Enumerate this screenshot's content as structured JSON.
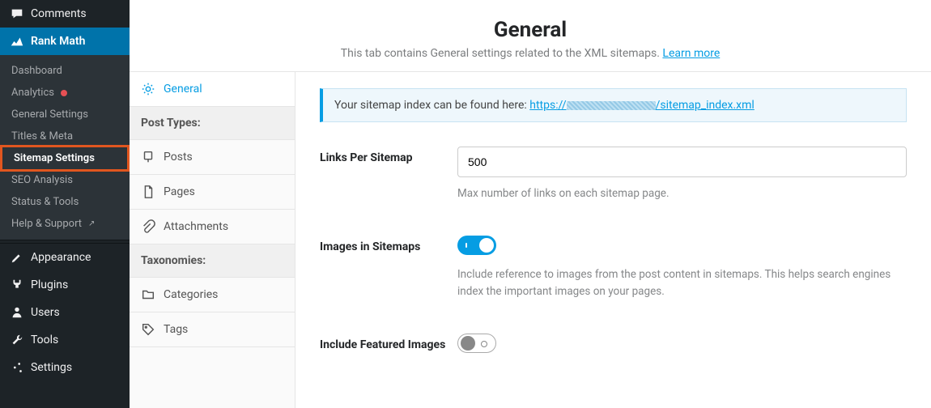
{
  "wp_menu": {
    "comments": "Comments",
    "rankmath": "Rank Math",
    "appearance": "Appearance",
    "plugins": "Plugins",
    "users": "Users",
    "tools": "Tools",
    "settings": "Settings"
  },
  "rm_submenu": {
    "dashboard": "Dashboard",
    "analytics": "Analytics",
    "general_settings": "General Settings",
    "titles_meta": "Titles & Meta",
    "sitemap_settings": "Sitemap Settings",
    "seo_analysis": "SEO Analysis",
    "status_tools": "Status & Tools",
    "help_support": "Help & Support"
  },
  "page": {
    "title": "General",
    "subtitle": "This tab contains General settings related to the XML sitemaps. ",
    "learn_more": "Learn more"
  },
  "tabs": {
    "general": "General",
    "post_types_header": "Post Types:",
    "posts": "Posts",
    "pages": "Pages",
    "attachments": "Attachments",
    "taxonomies_header": "Taxonomies:",
    "categories": "Categories",
    "tags": "Tags"
  },
  "notice": {
    "prefix": "Your sitemap index can be found here: ",
    "url_scheme": "https://",
    "url_path": "/sitemap_index.xml"
  },
  "fields": {
    "links_per_sitemap": {
      "label": "Links Per Sitemap",
      "value": "500",
      "help": "Max number of links on each sitemap page."
    },
    "images_in_sitemaps": {
      "label": "Images in Sitemaps",
      "help": "Include reference to images from the post content in sitemaps. This helps search engines index the important images on your pages."
    },
    "include_featured": {
      "label": "Include Featured Images"
    }
  }
}
